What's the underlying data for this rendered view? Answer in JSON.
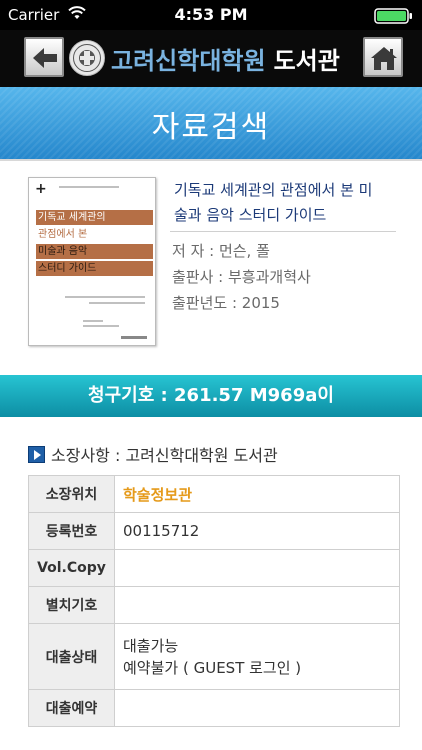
{
  "status_bar": {
    "carrier": "Carrier",
    "time": "4:53 PM"
  },
  "nav": {
    "school": "고려신학대학원",
    "library": "도서관",
    "back_icon": "back-arrow-icon",
    "home_icon": "home-icon"
  },
  "section": {
    "title": "자료검색"
  },
  "book": {
    "title": "기독교 세계관의 관점에서 본 미술과 음악 스터디 가이드",
    "title_line1": "기독교 세계관의 관점에서 본 미",
    "title_line2": "술과 음악 스터디 가이드",
    "author": "저 자 : 먼슨, 폴",
    "publisher": "출판사 : 부흥과개혁사",
    "year": "출판년도 : 2015",
    "cover": {
      "line1": "기독교 세계관의",
      "line2": "관점에서 본",
      "line3": "미술과 음악",
      "line4": "스터디 가이드"
    }
  },
  "call_number": {
    "text": "청구기호 : 261.57 M969a이"
  },
  "holdings": {
    "heading": "소장사항 : 고려신학대학원 도서관",
    "rows": [
      {
        "label": "소장위치",
        "value": "학술정보관"
      },
      {
        "label": "등록번호",
        "value": "00115712"
      },
      {
        "label": "Vol.Copy",
        "value": ""
      },
      {
        "label": "별치기호",
        "value": ""
      },
      {
        "label": "대출상태",
        "value_line1": "대출가능",
        "value_line2": "예약불가 ( GUEST 로그인 )"
      },
      {
        "label": "대출예약",
        "value": ""
      }
    ]
  },
  "colors": {
    "accent_orange": "#e59a1a",
    "title_blue": "#1c3a78",
    "header_blue": "#2587cc",
    "call_bar_teal": "#0d8ea4"
  }
}
